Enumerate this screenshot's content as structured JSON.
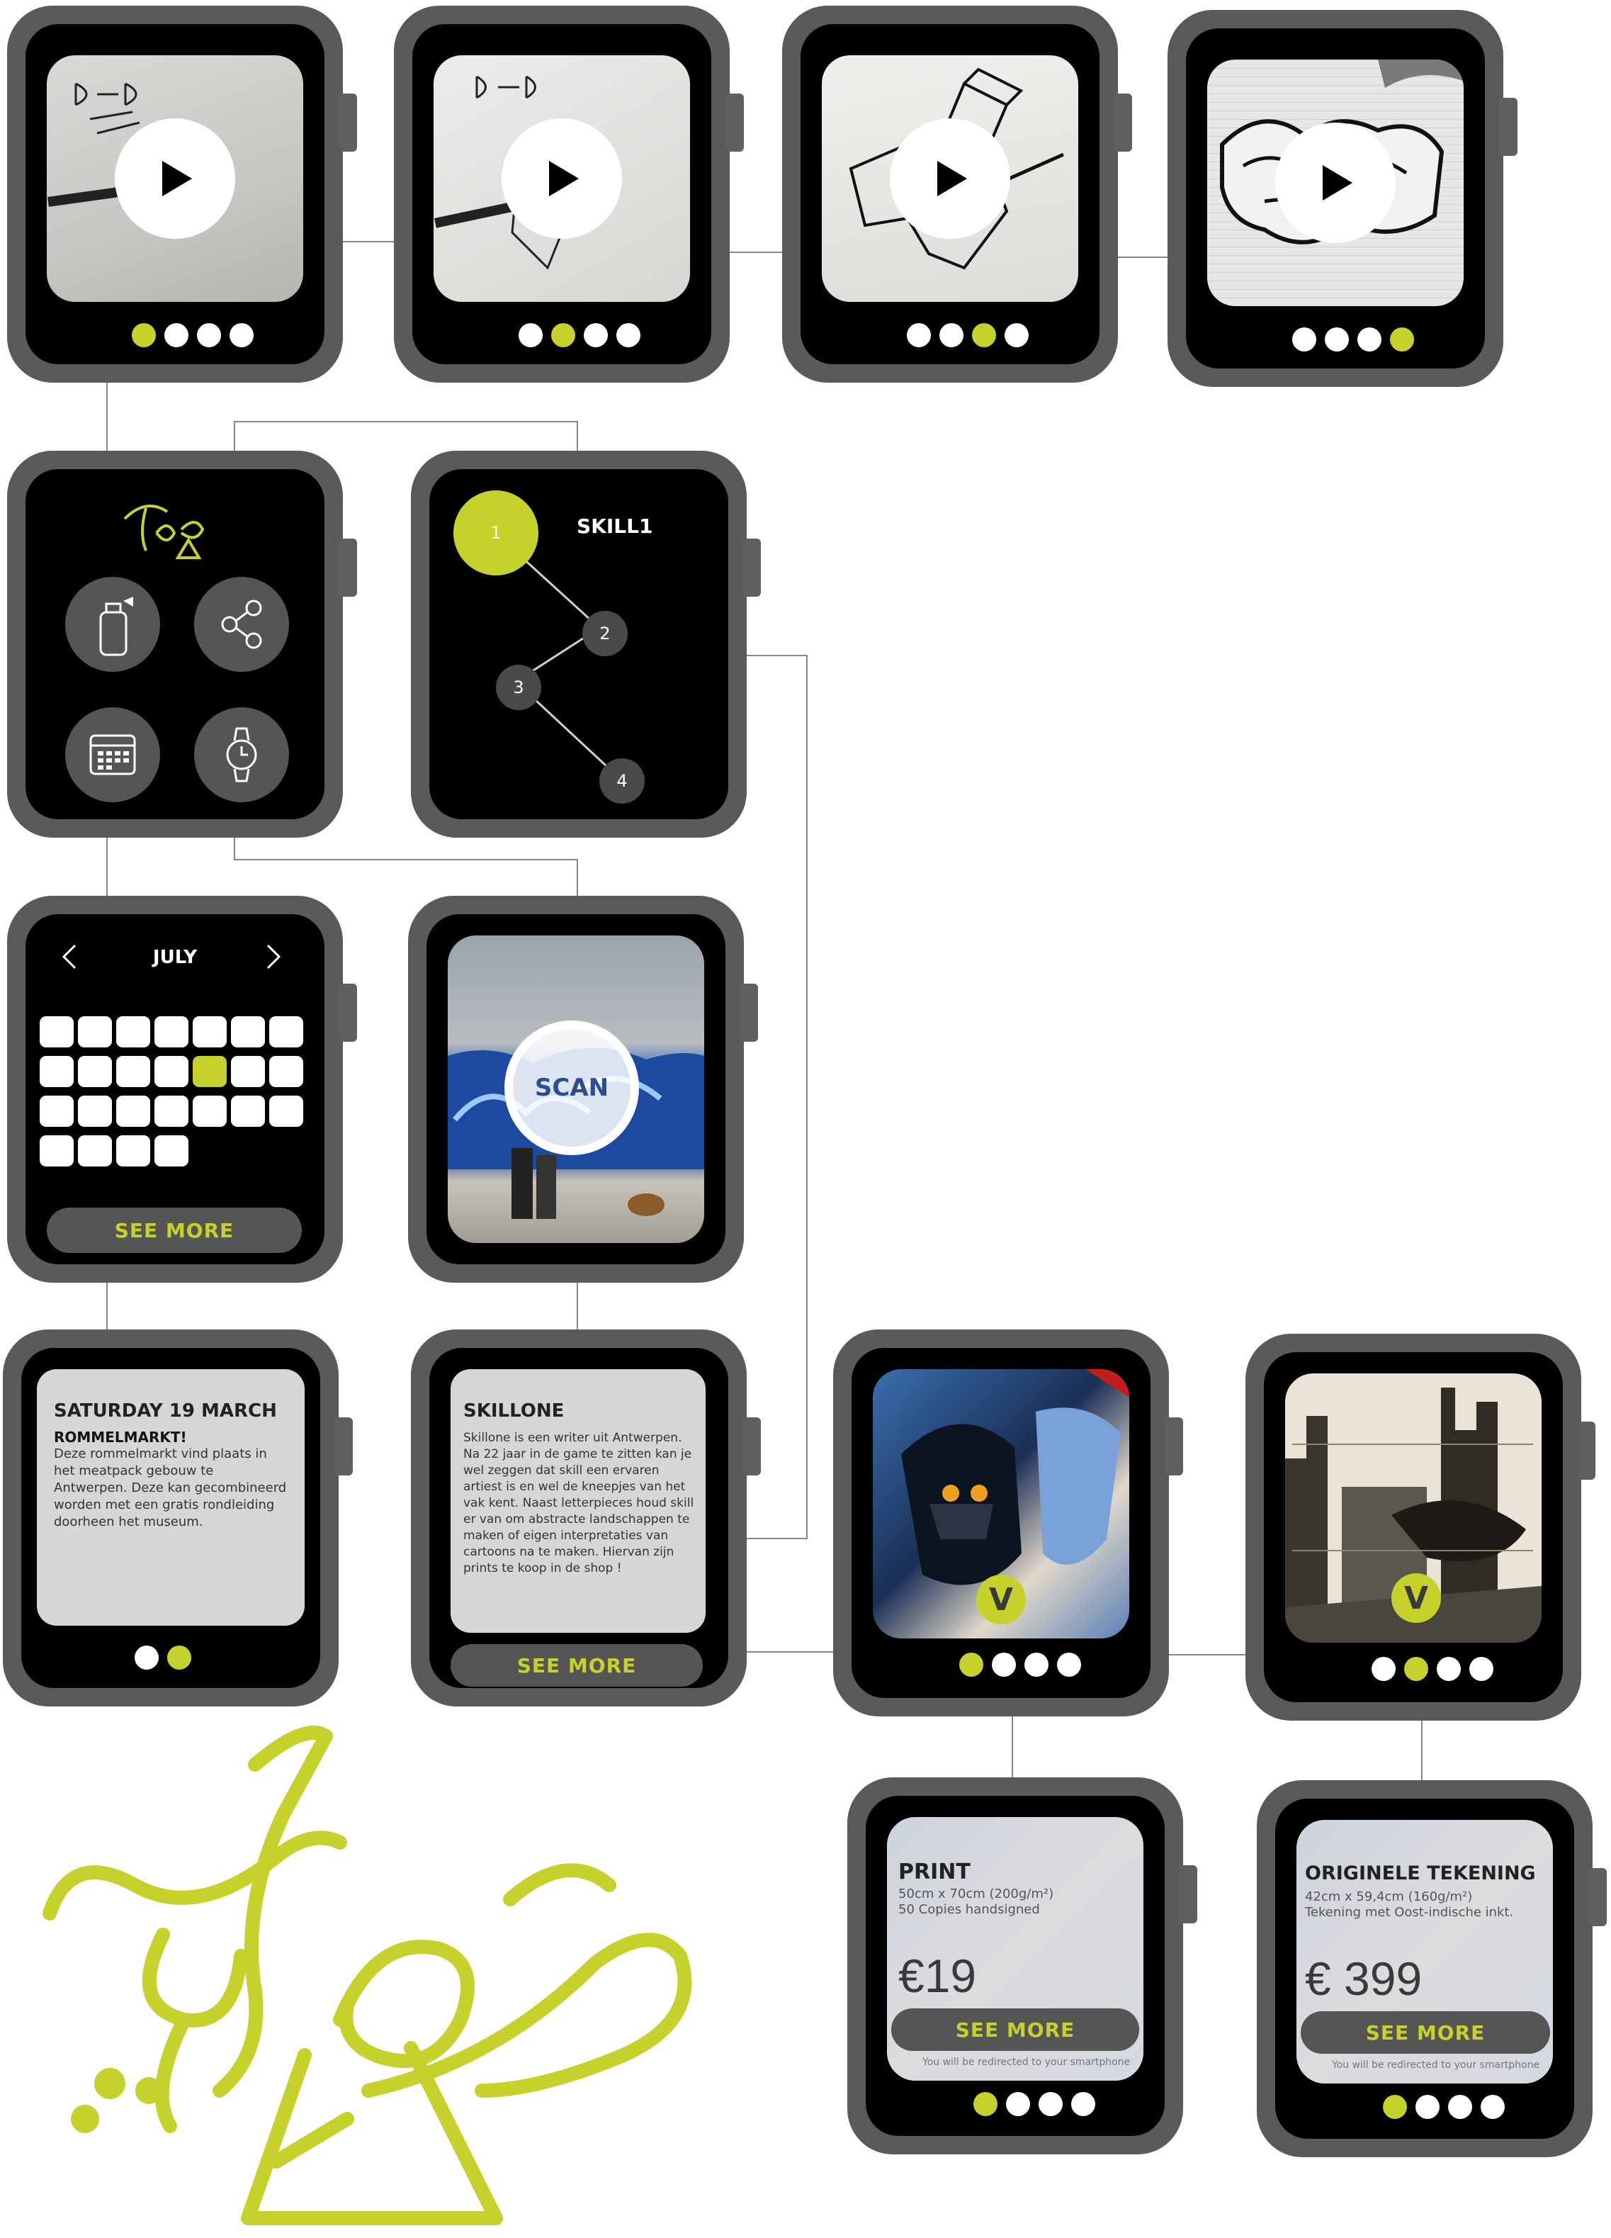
{
  "brand": {
    "tag": "TAOB",
    "accent": "#c6d22b"
  },
  "skill": {
    "title": "SKILL1",
    "nodes": [
      "1",
      "2",
      "3",
      "4"
    ]
  },
  "calendar": {
    "month": "JULY",
    "prev_icon": "chevron-left-icon",
    "next_icon": "chevron-right-icon",
    "see_more": "SEE MORE"
  },
  "scan": {
    "label": "SCAN"
  },
  "event": {
    "title": "SATURDAY 19 MARCH",
    "subtitle": "ROMMELMARKT!",
    "body": "Deze rommelmarkt vind plaats in het meatpack gebouw te Antwerpen. Deze kan gecombineerd worden met een gratis rondleiding doorheen het museum."
  },
  "artist": {
    "title": "SKILLONE",
    "body": "Skillone is een writer uit Antwerpen. Na 22 jaar in de game te zitten kan je wel zeggen dat skill een ervaren artiest is en wel de kneepjes van het vak kent. Naast letterpieces houd skill er van om abstracte landschappen te maken of eigen interpretaties van cartoons na te maken. Hiervan zijn prints te koop in de shop !",
    "see_more": "SEE MORE"
  },
  "vote_badge": "V",
  "print": {
    "title": "PRINT",
    "size": "50cm x 70cm (200g/m²)",
    "copies": "50 Copies handsigned",
    "price": "€19",
    "see_more": "SEE MORE",
    "note": "You will be redirected to your smartphone"
  },
  "original": {
    "title": "ORIGINELE TEKENING",
    "size": "42cm x 59,4cm (160g/m²)",
    "desc": "Tekening met Oost-indische inkt.",
    "price": "€ 399",
    "see_more": "SEE MORE",
    "note": "You will be redirected to your smartphone"
  },
  "menu_icons": [
    "spray-can-icon",
    "share-icon",
    "calendar-icon",
    "watch-icon"
  ]
}
